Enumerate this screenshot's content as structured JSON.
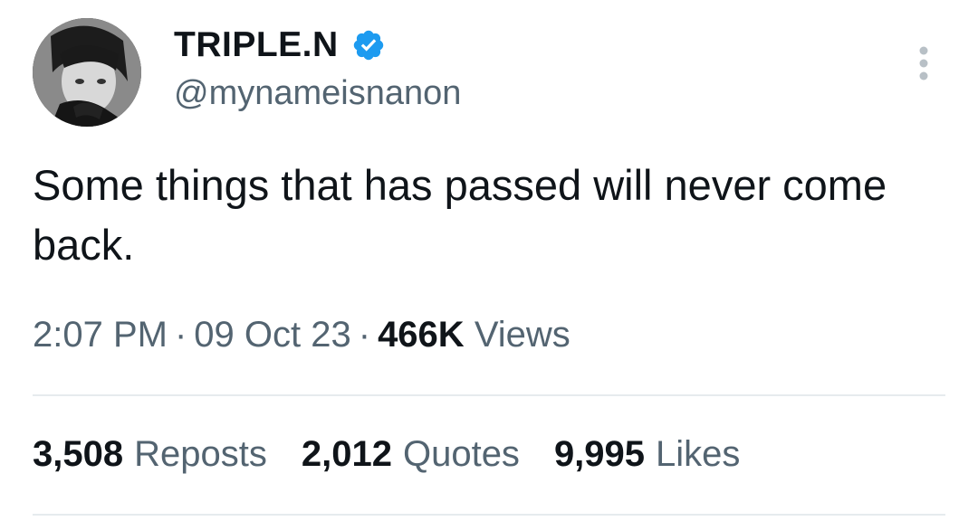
{
  "author": {
    "display_name": "TRIPLE.N",
    "handle": "@mynameisnanon",
    "avatar_icon": "profile-photo",
    "verified_icon": "verified-badge-icon",
    "verified_color": "#1d9bf0"
  },
  "tweet": {
    "text": "Some things that has passed will never come back."
  },
  "meta": {
    "time": "2:07 PM",
    "separator": "·",
    "date": "09 Oct 23",
    "views_count": "466K",
    "views_label": "Views"
  },
  "stats": {
    "reposts_count": "3,508",
    "reposts_label": "Reposts",
    "quotes_count": "2,012",
    "quotes_label": "Quotes",
    "likes_count": "9,995",
    "likes_label": "Likes"
  },
  "colors": {
    "text_primary": "#0f1419",
    "text_secondary": "#536471",
    "divider": "#e6ebee"
  }
}
